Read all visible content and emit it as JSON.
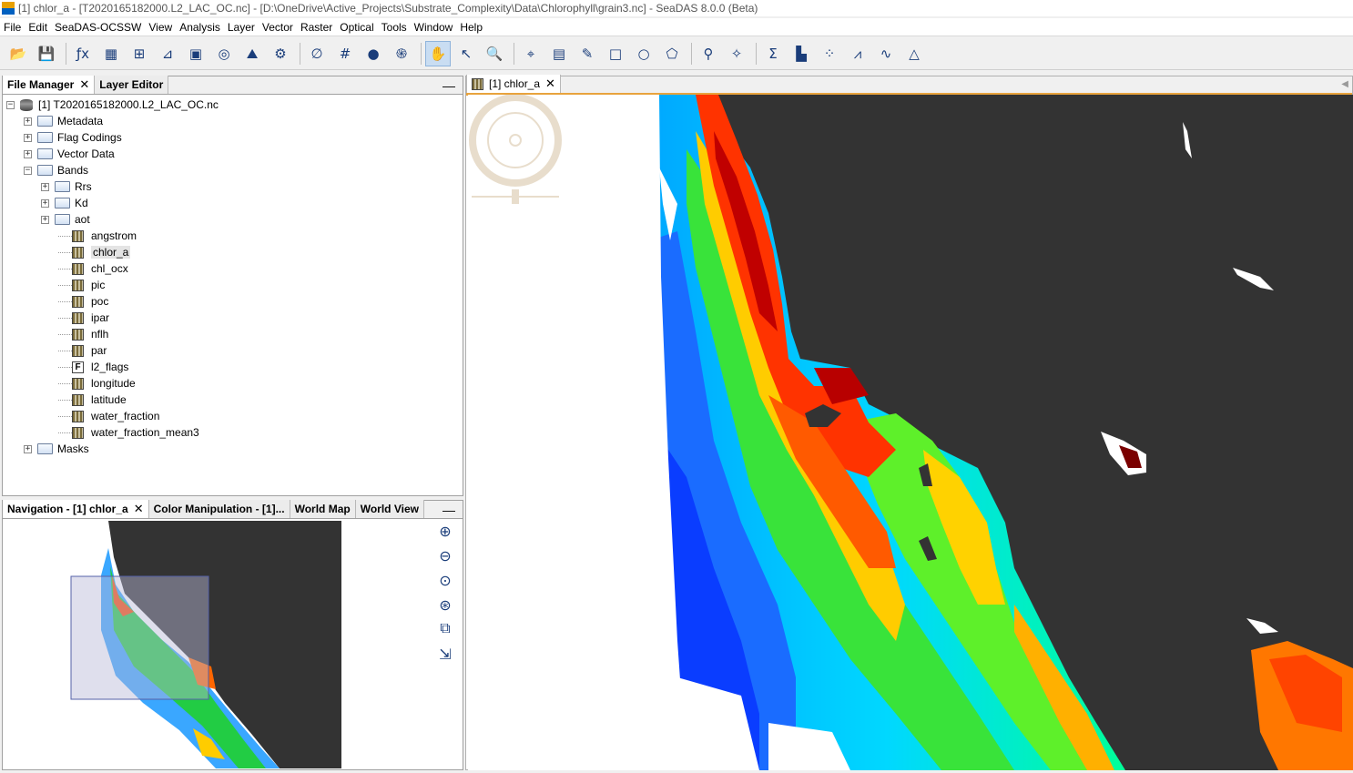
{
  "window": {
    "title": "[1] chlor_a - [T2020165182000.L2_LAC_OC.nc] - [D:\\OneDrive\\Active_Projects\\Substrate_Complexity\\Data\\Chlorophyll\\grain3.nc] - SeaDAS 8.0.0 (Beta)"
  },
  "menubar": [
    "File",
    "Edit",
    "SeaDAS-OCSSW",
    "View",
    "Analysis",
    "Layer",
    "Vector",
    "Raster",
    "Optical",
    "Tools",
    "Window",
    "Help"
  ],
  "toolbar": [
    {
      "icon": "open-product-icon",
      "glyph": "📂"
    },
    {
      "icon": "save-product-icon",
      "glyph": "💾"
    },
    {
      "sep": true
    },
    {
      "icon": "band-maths-icon",
      "glyph": "ƒx"
    },
    {
      "icon": "rgb-image-icon",
      "glyph": "▦"
    },
    {
      "icon": "subset-icon",
      "glyph": "⊞"
    },
    {
      "icon": "reprojection-icon",
      "glyph": "⊿"
    },
    {
      "icon": "mosaic-icon",
      "glyph": "▣"
    },
    {
      "icon": "collocation-icon",
      "glyph": "◎"
    },
    {
      "icon": "terrain-icon",
      "glyph": "⛰"
    },
    {
      "icon": "graph-builder-icon",
      "glyph": "⚙"
    },
    {
      "sep": true
    },
    {
      "icon": "no-data-icon",
      "glyph": "∅"
    },
    {
      "icon": "graticule-icon",
      "glyph": "#"
    },
    {
      "icon": "world-icon",
      "glyph": "●"
    },
    {
      "icon": "fingerprint-icon",
      "glyph": "֍"
    },
    {
      "sep": true
    },
    {
      "icon": "pan-tool-icon",
      "glyph": "✋",
      "active": true
    },
    {
      "icon": "select-tool-icon",
      "glyph": "↖"
    },
    {
      "icon": "zoom-tool-icon",
      "glyph": "🔍"
    },
    {
      "sep": true
    },
    {
      "icon": "pin-manager-icon",
      "glyph": "⌖"
    },
    {
      "icon": "pixel-info-icon",
      "glyph": "▤"
    },
    {
      "icon": "drawing-line-icon",
      "glyph": "✎"
    },
    {
      "icon": "rectangle-tool-icon",
      "glyph": "□"
    },
    {
      "icon": "ellipse-tool-icon",
      "glyph": "○"
    },
    {
      "icon": "polygon-tool-icon",
      "glyph": "⬠"
    },
    {
      "sep": true
    },
    {
      "icon": "range-finder-icon",
      "glyph": "⚲"
    },
    {
      "icon": "magic-wand-icon",
      "glyph": "✧"
    },
    {
      "sep": true
    },
    {
      "icon": "statistics-icon",
      "glyph": "Σ"
    },
    {
      "icon": "histogram-icon",
      "glyph": "▙"
    },
    {
      "icon": "scatter-plot-icon",
      "glyph": "⁘"
    },
    {
      "icon": "profile-plot-icon",
      "glyph": "⩘"
    },
    {
      "icon": "spectrum-icon",
      "glyph": "∿"
    },
    {
      "icon": "information-icon",
      "glyph": "△"
    }
  ],
  "product_panel": {
    "tabs": [
      {
        "label": "File Manager",
        "selected": true
      },
      {
        "label": "Layer Editor",
        "selected": false
      }
    ],
    "tree": [
      {
        "level": 0,
        "kind": "product",
        "label": "[1] T2020165182000.L2_LAC_OC.nc",
        "exp": "−"
      },
      {
        "level": 1,
        "kind": "folder",
        "label": "Metadata",
        "exp": "+"
      },
      {
        "level": 1,
        "kind": "folder",
        "label": "Flag Codings",
        "exp": "+"
      },
      {
        "level": 1,
        "kind": "folder",
        "label": "Vector Data",
        "exp": "+"
      },
      {
        "level": 1,
        "kind": "folder-open",
        "label": "Bands",
        "exp": "−"
      },
      {
        "level": 2,
        "kind": "folder",
        "label": "Rrs",
        "exp": "+"
      },
      {
        "level": 2,
        "kind": "folder",
        "label": "Kd",
        "exp": "+"
      },
      {
        "level": 2,
        "kind": "folder",
        "label": "aot",
        "exp": "+"
      },
      {
        "level": 3,
        "kind": "band",
        "label": "angstrom"
      },
      {
        "level": 3,
        "kind": "band",
        "label": "chlor_a",
        "highlight": true
      },
      {
        "level": 3,
        "kind": "band",
        "label": "chl_ocx"
      },
      {
        "level": 3,
        "kind": "band",
        "label": "pic"
      },
      {
        "level": 3,
        "kind": "band",
        "label": "poc"
      },
      {
        "level": 3,
        "kind": "band",
        "label": "ipar"
      },
      {
        "level": 3,
        "kind": "band",
        "label": "nflh"
      },
      {
        "level": 3,
        "kind": "band",
        "label": "par"
      },
      {
        "level": 3,
        "kind": "flag",
        "label": "l2_flags"
      },
      {
        "level": 3,
        "kind": "band",
        "label": "longitude"
      },
      {
        "level": 3,
        "kind": "band",
        "label": "latitude"
      },
      {
        "level": 3,
        "kind": "band",
        "label": "water_fraction"
      },
      {
        "level": 3,
        "kind": "band",
        "label": "water_fraction_mean3"
      },
      {
        "level": 1,
        "kind": "folder",
        "label": "Masks",
        "exp": "+"
      }
    ]
  },
  "nav_panel": {
    "tabs": [
      {
        "label": "Navigation - [1] chlor_a",
        "selected": true,
        "closable": true
      },
      {
        "label": "Color Manipulation - [1]...",
        "selected": false
      },
      {
        "label": "World Map",
        "selected": false
      },
      {
        "label": "World View",
        "selected": false
      }
    ],
    "tools": [
      "zoom-in-icon",
      "zoom-out-icon",
      "zoom-pixel-icon",
      "zoom-all-icon",
      "sync-views-icon",
      "sync-cursor-icon"
    ],
    "tool_glyphs": [
      "⊕",
      "⊖",
      "⊙",
      "⊛",
      "⧉",
      "⇲"
    ]
  },
  "image_view": {
    "tab_label": "[1] chlor_a",
    "colors": {
      "land": "#333333",
      "nodata": "#ffffff",
      "low": "#0044ff",
      "mid": "#00ee00",
      "high": "#ff2200",
      "max": "#8b0000"
    }
  },
  "glyphs": {
    "close": "✕",
    "minimize": "—",
    "scroll_left": "◀"
  }
}
